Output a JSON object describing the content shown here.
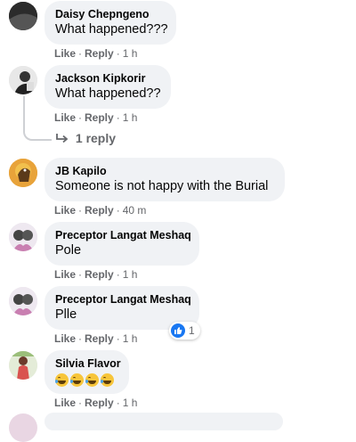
{
  "comments": [
    {
      "author": "Daisy Chepngeno",
      "text": "What happened???",
      "like": "Like",
      "reply": "Reply",
      "time": "1 h"
    },
    {
      "author": "Jackson Kipkorir",
      "text": "What happened??",
      "like": "Like",
      "reply": "Reply",
      "time": "1 h"
    },
    {
      "author": "JB Kapilo",
      "text": "Someone is not happy with the Burial",
      "like": "Like",
      "reply": "Reply",
      "time": "40 m"
    },
    {
      "author": "Preceptor Langat Meshaq",
      "text": "Pole",
      "like": "Like",
      "reply": "Reply",
      "time": "1 h"
    },
    {
      "author": "Preceptor Langat Meshaq",
      "text": "Plle",
      "like": "Like",
      "reply": "Reply",
      "time": "1 h",
      "reaction_count": "1"
    },
    {
      "author": "Silvia Flavor",
      "text": "",
      "like": "Like",
      "reply": "Reply",
      "time": "1 h"
    }
  ],
  "thread": {
    "replies_label": "1 reply"
  },
  "separator": "·",
  "colors": {
    "bubble": "#f0f2f5",
    "meta": "#65676b",
    "like_blue": "#1877f2"
  }
}
